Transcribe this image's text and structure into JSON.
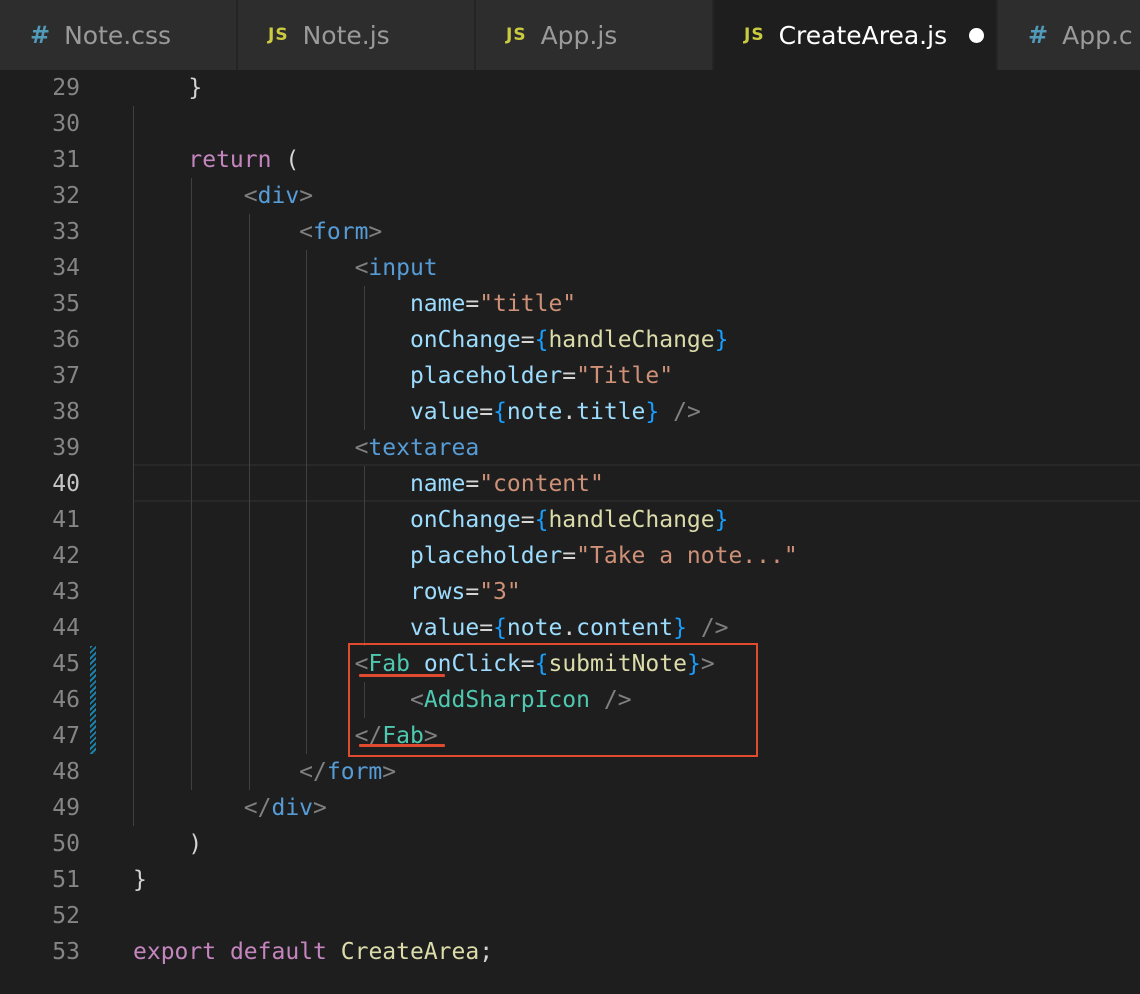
{
  "tabs": [
    {
      "label": "Note.css",
      "icon": "#",
      "icon_name": "css-file-icon",
      "active": false
    },
    {
      "label": "Note.js",
      "icon": "JS",
      "icon_name": "js-file-icon",
      "active": false
    },
    {
      "label": "App.js",
      "icon": "JS",
      "icon_name": "js-file-icon",
      "active": false
    },
    {
      "label": "CreateArea.js",
      "icon": "JS",
      "icon_name": "js-file-icon",
      "active": true,
      "unsaved": true
    },
    {
      "label": "App.c",
      "icon": "#",
      "icon_name": "css-file-icon",
      "active": false
    }
  ],
  "editor": {
    "current_line": "40",
    "lines": [
      {
        "n": "29",
        "t": [
          [
            "    }",
            "p"
          ]
        ]
      },
      {
        "n": "30",
        "t": []
      },
      {
        "n": "31",
        "t": [
          [
            "    ",
            "p"
          ],
          [
            "return",
            "kw"
          ],
          [
            " (",
            "p"
          ]
        ]
      },
      {
        "n": "32",
        "t": [
          [
            "        ",
            "p"
          ],
          [
            "<",
            "pun"
          ],
          [
            "div",
            "tag"
          ],
          [
            ">",
            "pun"
          ]
        ]
      },
      {
        "n": "33",
        "t": [
          [
            "            ",
            "p"
          ],
          [
            "<",
            "pun"
          ],
          [
            "form",
            "tag"
          ],
          [
            ">",
            "pun"
          ]
        ]
      },
      {
        "n": "34",
        "t": [
          [
            "                ",
            "p"
          ],
          [
            "<",
            "pun"
          ],
          [
            "input",
            "tag"
          ]
        ]
      },
      {
        "n": "35",
        "t": [
          [
            "                    ",
            "p"
          ],
          [
            "name",
            "attr"
          ],
          [
            "=",
            "p"
          ],
          [
            "\"title\"",
            "str"
          ]
        ]
      },
      {
        "n": "36",
        "t": [
          [
            "                    ",
            "p"
          ],
          [
            "onChange",
            "attr"
          ],
          [
            "=",
            "p"
          ],
          [
            "{",
            "brc"
          ],
          [
            "handleChange",
            "fn"
          ],
          [
            "}",
            "brc"
          ]
        ]
      },
      {
        "n": "37",
        "t": [
          [
            "                    ",
            "p"
          ],
          [
            "placeholder",
            "attr"
          ],
          [
            "=",
            "p"
          ],
          [
            "\"Title\"",
            "str"
          ]
        ]
      },
      {
        "n": "38",
        "t": [
          [
            "                    ",
            "p"
          ],
          [
            "value",
            "attr"
          ],
          [
            "=",
            "p"
          ],
          [
            "{",
            "brc"
          ],
          [
            "note",
            "attr"
          ],
          [
            ".",
            "p"
          ],
          [
            "title",
            "attr"
          ],
          [
            "}",
            "brc"
          ],
          [
            " ",
            "p"
          ],
          [
            "/>",
            "pun"
          ]
        ]
      },
      {
        "n": "39",
        "t": [
          [
            "                ",
            "p"
          ],
          [
            "<",
            "pun"
          ],
          [
            "textarea",
            "tag"
          ]
        ]
      },
      {
        "n": "40",
        "t": [
          [
            "                    ",
            "p"
          ],
          [
            "name",
            "attr"
          ],
          [
            "=",
            "p"
          ],
          [
            "\"content\"",
            "str"
          ]
        ]
      },
      {
        "n": "41",
        "t": [
          [
            "                    ",
            "p"
          ],
          [
            "onChange",
            "attr"
          ],
          [
            "=",
            "p"
          ],
          [
            "{",
            "brc"
          ],
          [
            "handleChange",
            "fn"
          ],
          [
            "}",
            "brc"
          ]
        ]
      },
      {
        "n": "42",
        "t": [
          [
            "                    ",
            "p"
          ],
          [
            "placeholder",
            "attr"
          ],
          [
            "=",
            "p"
          ],
          [
            "\"Take a note...\"",
            "str"
          ]
        ]
      },
      {
        "n": "43",
        "t": [
          [
            "                    ",
            "p"
          ],
          [
            "rows",
            "attr"
          ],
          [
            "=",
            "p"
          ],
          [
            "\"3\"",
            "str"
          ]
        ]
      },
      {
        "n": "44",
        "t": [
          [
            "                    ",
            "p"
          ],
          [
            "value",
            "attr"
          ],
          [
            "=",
            "p"
          ],
          [
            "{",
            "brc"
          ],
          [
            "note",
            "attr"
          ],
          [
            ".",
            "p"
          ],
          [
            "content",
            "attr"
          ],
          [
            "}",
            "brc"
          ],
          [
            " ",
            "p"
          ],
          [
            "/>",
            "pun"
          ]
        ]
      },
      {
        "n": "45",
        "t": [
          [
            "                ",
            "p"
          ],
          [
            "<",
            "pun"
          ],
          [
            "Fab",
            "cmp"
          ],
          [
            " ",
            "p"
          ],
          [
            "onClick",
            "attr"
          ],
          [
            "=",
            "p"
          ],
          [
            "{",
            "brc"
          ],
          [
            "submitNote",
            "fn"
          ],
          [
            "}",
            "brc"
          ],
          [
            ">",
            "pun"
          ]
        ]
      },
      {
        "n": "46",
        "t": [
          [
            "                    ",
            "p"
          ],
          [
            "<",
            "pun"
          ],
          [
            "AddSharpIcon",
            "cmp"
          ],
          [
            " ",
            "p"
          ],
          [
            "/>",
            "pun"
          ]
        ]
      },
      {
        "n": "47",
        "t": [
          [
            "                ",
            "p"
          ],
          [
            "</",
            "pun"
          ],
          [
            "Fab",
            "cmp"
          ],
          [
            ">",
            "pun"
          ]
        ]
      },
      {
        "n": "48",
        "t": [
          [
            "            ",
            "p"
          ],
          [
            "</",
            "pun"
          ],
          [
            "form",
            "tag"
          ],
          [
            ">",
            "pun"
          ]
        ]
      },
      {
        "n": "49",
        "t": [
          [
            "        ",
            "p"
          ],
          [
            "</",
            "pun"
          ],
          [
            "div",
            "tag"
          ],
          [
            ">",
            "pun"
          ]
        ]
      },
      {
        "n": "50",
        "t": [
          [
            "    )",
            "p"
          ]
        ]
      },
      {
        "n": "51",
        "t": [
          [
            "}",
            "p"
          ]
        ]
      },
      {
        "n": "52",
        "t": []
      },
      {
        "n": "53",
        "t": [
          [
            "export",
            "kw"
          ],
          [
            " ",
            "p"
          ],
          [
            "default",
            "kw"
          ],
          [
            " ",
            "p"
          ],
          [
            "CreateArea",
            "fn"
          ],
          [
            ";",
            "p"
          ]
        ]
      }
    ]
  },
  "colors": {
    "background": "#1e1e1e",
    "keyword": "#c586c0",
    "tag": "#569cd6",
    "component": "#4ec9b0",
    "attribute": "#9cdcfe",
    "string": "#ce9178",
    "function": "#dcdcaa",
    "brace": "#179fff",
    "highlight_box": "#e04a2f"
  }
}
